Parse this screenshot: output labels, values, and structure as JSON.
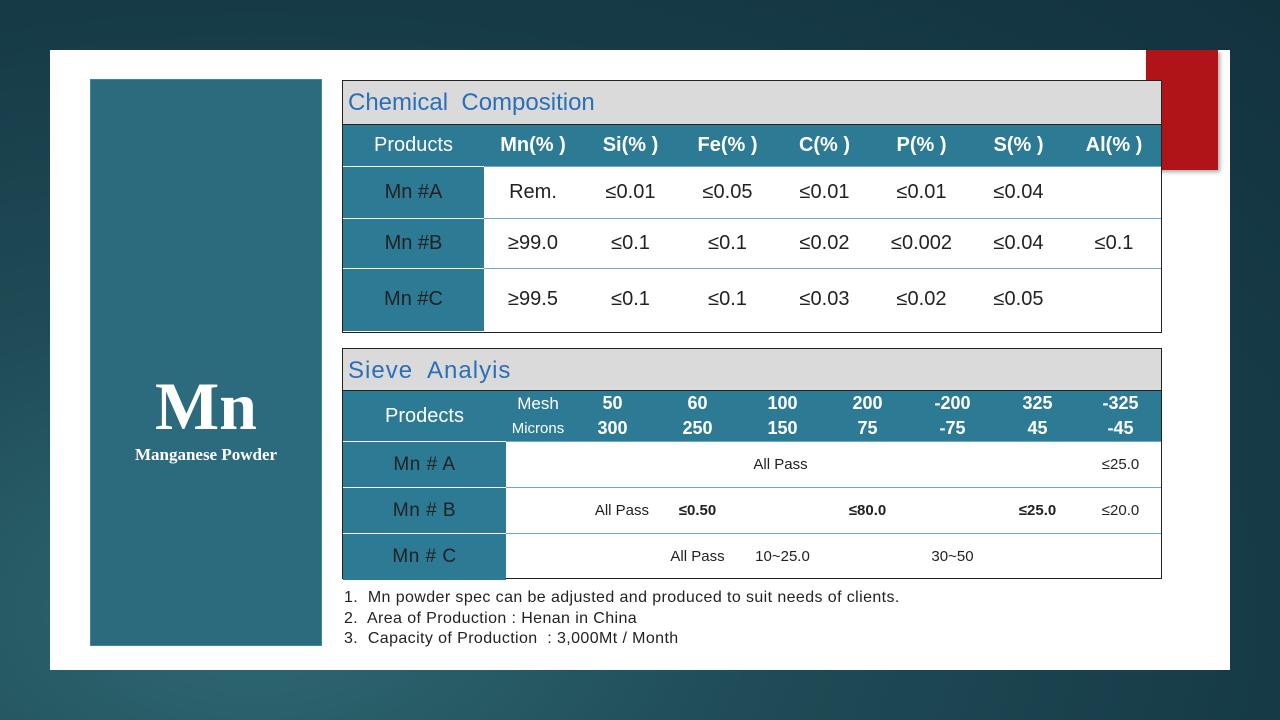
{
  "side": {
    "symbol": "Mn",
    "name": "Manganese Powder"
  },
  "chemical": {
    "title": "Chemical  Composition",
    "headers": [
      "Products",
      "Mn(% )",
      "Si(% )",
      "Fe(% )",
      "C(% )",
      "P(% )",
      "S(% )",
      "Al(% )"
    ],
    "rows": [
      [
        "Mn #A",
        "Rem.",
        "≤0.01",
        "≤0.05",
        "≤0.01",
        "≤0.01",
        "≤0.04",
        ""
      ],
      [
        "Mn #B",
        "≥99.0",
        "≤0.1",
        "≤0.1",
        "≤0.02",
        "≤0.002",
        "≤0.04",
        "≤0.1"
      ],
      [
        "Mn #C",
        "≥99.5",
        "≤0.1",
        "≤0.1",
        "≤0.03",
        "≤0.02",
        "≤0.05",
        ""
      ]
    ]
  },
  "sieve": {
    "title": "Sieve  Analyis",
    "products_label": "Prodects",
    "mesh_label": "Mesh",
    "microns_label": "Microns",
    "mesh": [
      "50",
      "60",
      "100",
      "200",
      "-200",
      "325",
      "-325"
    ],
    "microns": [
      "300",
      "250",
      "150",
      "75",
      "-75",
      "45",
      "-45"
    ],
    "rows": {
      "a": {
        "label": "Mn # A",
        "all_pass": "All Pass",
        "v325": "≤25.0"
      },
      "b": {
        "label": "Mn # B",
        "all_pass": "All Pass",
        "v60": "≤0.50",
        "v200": "≤80.0",
        "v325": "≤25.0",
        "vneg325": "≤20.0"
      },
      "c": {
        "label": "Mn # C",
        "all_pass": "All Pass",
        "v100": "10~25.0",
        "v200": "30~50"
      }
    }
  },
  "notes": [
    "1.  Mn powder spec can be adjusted and produced to suit needs of clients.",
    "2.  Area of Production : Henan in China",
    "3.  Capacity of Production  : 3,000Mt / Month"
  ]
}
